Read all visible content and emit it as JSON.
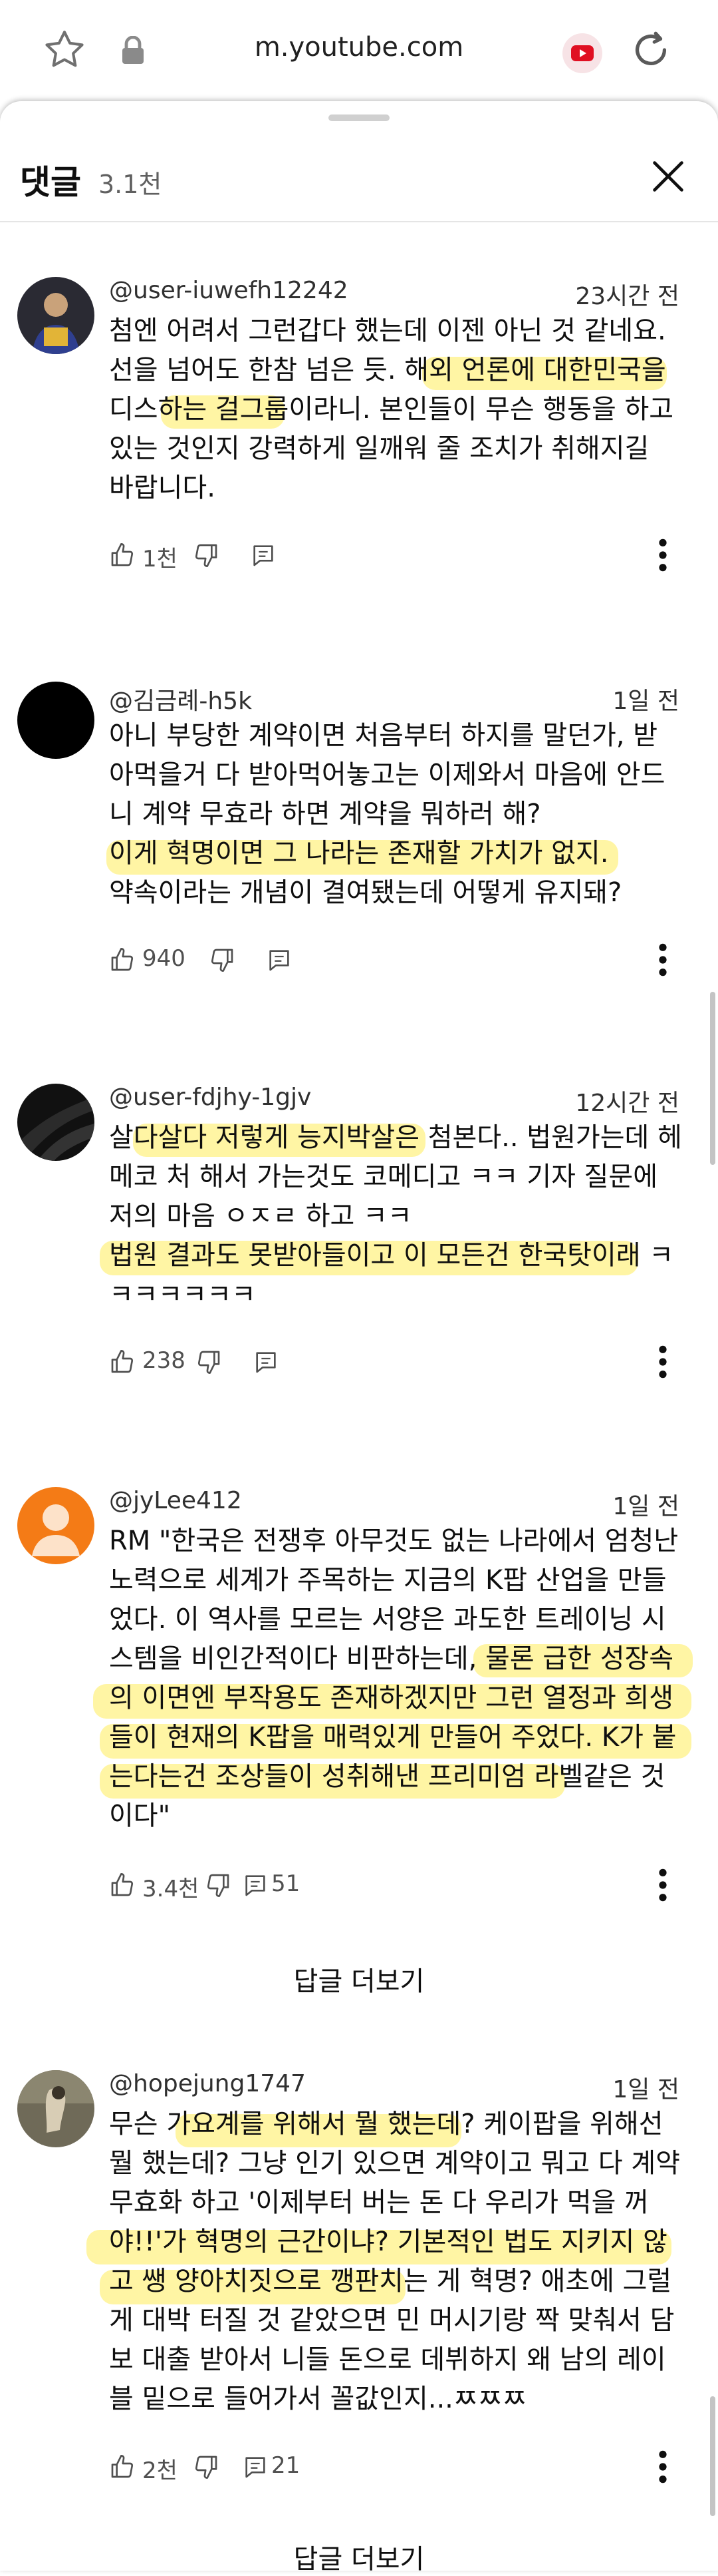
{
  "browser": {
    "url": "m.youtube.com"
  },
  "panel": {
    "title": "댓글",
    "count": "3.1천"
  },
  "comments": [
    {
      "author": "@user-iuwefh12242",
      "time": "23시간 전",
      "text": "첨엔 어려서 그런갑다 했는데 이젠 아닌 것 같네요.\n선을 넘어도 한참 넘은 듯. 해외 언론에 대한민국을\n디스하는 걸그룹이라니. 본인들이 무슨 행동을 하고\n있는 것인지 강력하게 일깨워 줄 조치가 취해지길\n바랍니다.",
      "likes": "1천",
      "replies": ""
    },
    {
      "author": "@김금례-h5k",
      "time": "1일 전",
      "text": "아니 부당한 계약이면 처음부터 하지를 말던가, 받\n아먹을거 다 받아먹어놓고는 이제와서 마음에 안드\n니 계약 무효라 하면 계약을 뭐하러 해?\n이게 혁명이면 그 나라는 존재할 가치가 없지.\n약속이라는 개념이 결여됐는데 어떻게 유지돼?",
      "likes": "940",
      "replies": ""
    },
    {
      "author": "@user-fdjhy-1gjv",
      "time": "12시간 전",
      "text": "살다살다 저렇게 능지박살은 첨본다.. 법원가는데 헤\n메코 처 해서 가는것도 코메디고 ㅋㅋ 기자 질문에\n저의 마음 ㅇㅈㄹ 하고 ㅋㅋ\n법원 결과도 못받아들이고 이 모든건 한국탓이래 ㅋ\nㅋㅋㅋㅋㅋㅋ",
      "likes": "238",
      "replies": ""
    },
    {
      "author": "@jyLee412",
      "time": "1일 전",
      "text": "RM \"한국은 전쟁후 아무것도 없는 나라에서 엄청난\n노력으로 세계가 주목하는 지금의 K팝 산업을 만들\n었다. 이 역사를 모르는 서양은 과도한 트레이닝 시\n스템을 비인간적이다 비판하는데, 물론 급한 성장속\n의 이면엔 부작용도 존재하겠지만 그런 열정과 희생\n들이 현재의 K팝을 매력있게 만들어 주었다. K가 붙\n는다는건 조상들이 성취해낸 프리미엄 라벨같은 것\n이다\"",
      "likes": "3.4천",
      "replies": "51"
    },
    {
      "author": "@hopejung1747",
      "time": "1일 전",
      "text": "무슨 가요계를 위해서 뭘 했는데? 케이팝을 위해선\n뭘 했는데? 그냥 인기 있으면 계약이고 뭐고 다 계약\n무효화 하고 '이제부터 버는 돈 다 우리가 먹을 꺼\n야!!'가 혁명의 근간이냐? 기본적인 법도 지키지 않\n고 쌩 양아치짓으로 깽판치는 게 혁명? 애초에 그럴\n게 대박 터질 것 같았으면 민 머시기랑 짝 맞춰서 담\n보 대출 받아서 니들 돈으로 데뷔하지 왜 남의 레이\n블 밑으로 들어가서 꼴값인지...ㅉㅉㅉ",
      "likes": "2천",
      "replies": "21"
    }
  ],
  "more_replies_label": "답글 더보기"
}
